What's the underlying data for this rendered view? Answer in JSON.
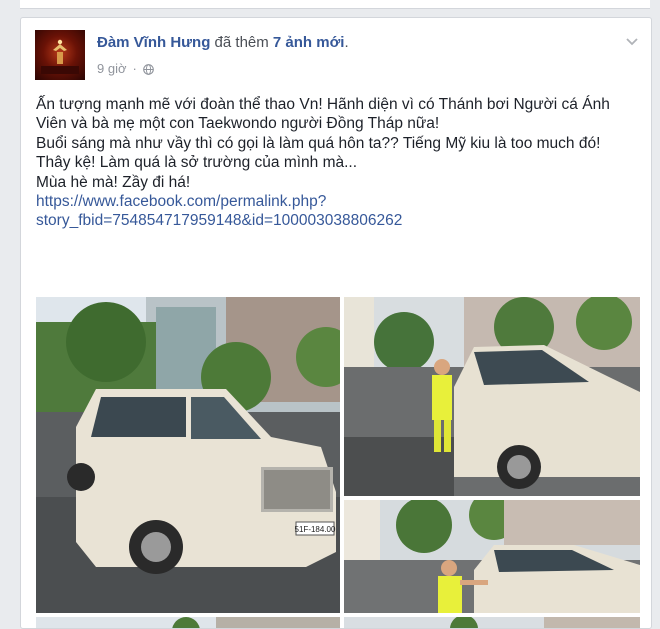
{
  "post": {
    "author": "Đàm Vĩnh Hưng",
    "action": "đã thêm",
    "photo_count_label": "7 ảnh mới",
    "action_suffix": ".",
    "timestamp": "9 giờ",
    "separator": "·",
    "audience_icon": "globe-icon",
    "menu_icon": "chevron-down-icon",
    "lines": [
      "Ấn tượng mạnh mẽ với đoàn thể thao Vn! Hãnh diện vì có Thánh bơi Người cá Ánh Viên và bà mẹ một con Taekwondo người Đồng Tháp nữa!",
      "Buổi sáng mà như vầy thì có gọi là làm quá hôn ta?? Tiếng Mỹ kiu là too much đó!",
      "Thây kệ! Làm quá là sở trường của mình mà...",
      "Mùa hè mà! Zầy đi há!"
    ],
    "link": "https://www.facebook.com/permalink.php?story_fbid=754854717959148&id=100003038806262"
  },
  "photos": {
    "plate_text": "51F-184.00"
  },
  "colors": {
    "link": "#365899",
    "text": "#1d2129",
    "meta": "#90949c",
    "background": "#e9ebee"
  }
}
